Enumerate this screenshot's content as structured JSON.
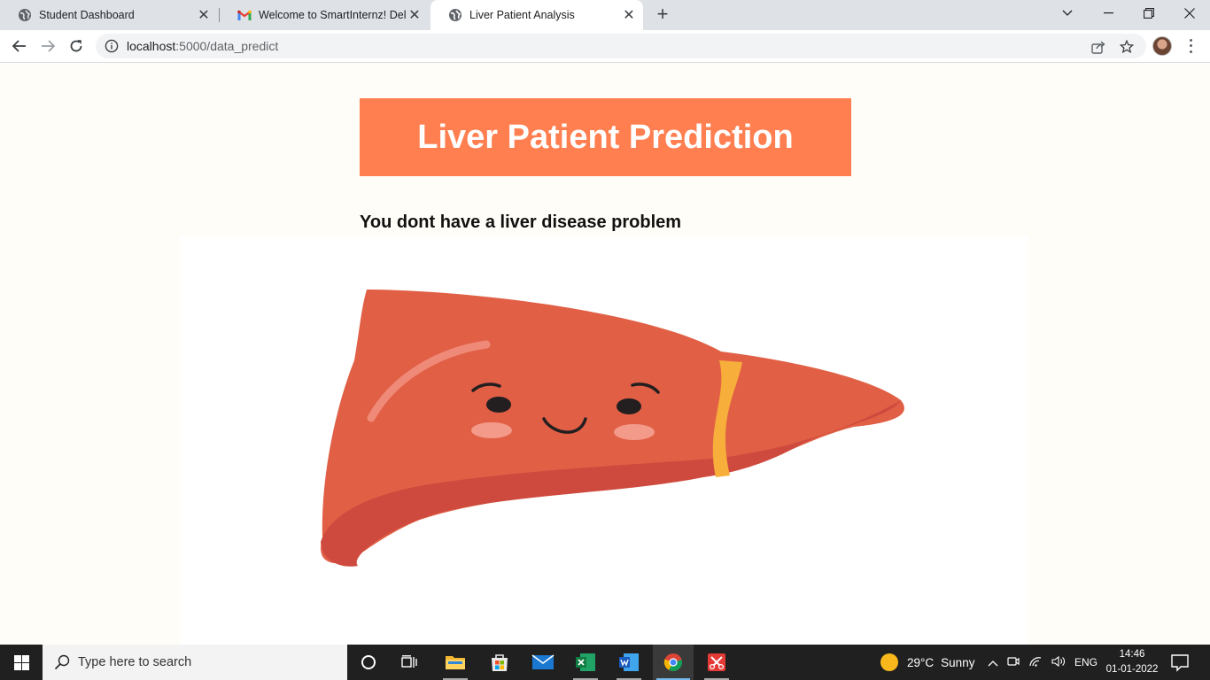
{
  "browser": {
    "tabs": [
      {
        "title": "Student Dashboard",
        "active": false
      },
      {
        "title": "Welcome to SmartInternz! Deligh",
        "active": false
      },
      {
        "title": "Liver Patient Analysis",
        "active": true
      }
    ],
    "url_host": "localhost",
    "url_path": ":5000/data_predict"
  },
  "page": {
    "heading": "Liver Patient Prediction",
    "result_text": "You dont have a liver disease problem",
    "image_name": "liver-illustration"
  },
  "taskbar": {
    "search_placeholder": "Type here to search",
    "weather_temp": "29°C",
    "weather_desc": "Sunny",
    "language": "ENG",
    "time": "14:46",
    "date": "01-01-2022"
  },
  "colors": {
    "header_bg": "#ff7f50",
    "page_bg": "#fffdf7",
    "liver": "#e05f45"
  }
}
